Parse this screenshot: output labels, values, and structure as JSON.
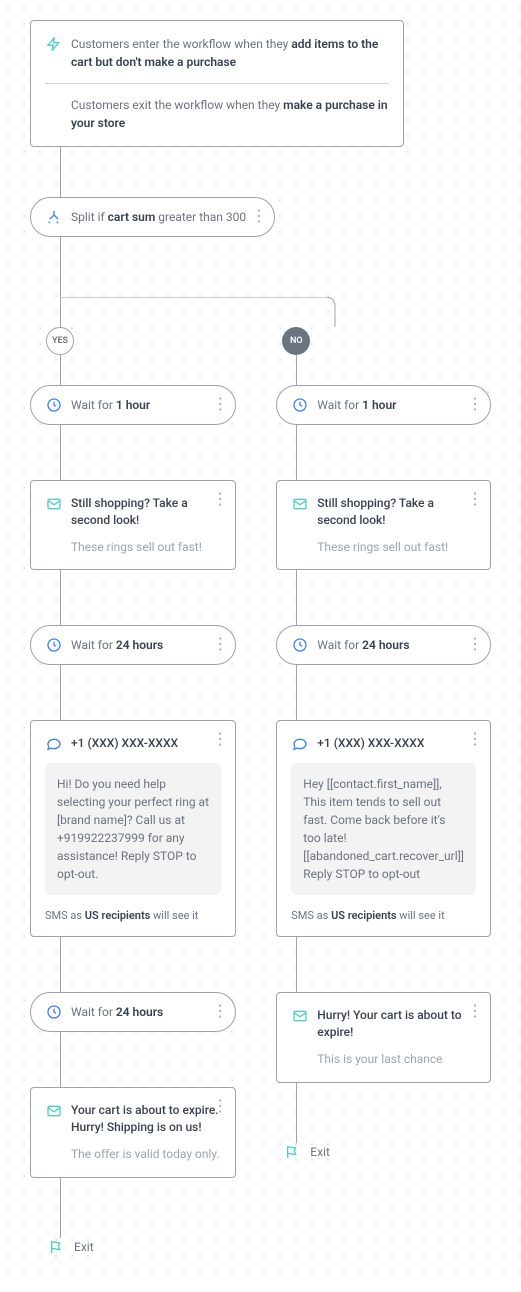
{
  "entry": {
    "part1": "Customers enter the workflow when they ",
    "bold1": "add items to the cart but don't make a purchase",
    "part2": "Customers exit the workflow when they ",
    "bold2": "make a purchase in your store"
  },
  "split": {
    "pre": "Split if ",
    "bold": "cart sum",
    "post": " greater than 300"
  },
  "badges": {
    "yes": "YES",
    "no": "NO"
  },
  "exit": "Exit",
  "yes": {
    "wait1": {
      "pre": "Wait for ",
      "dur": "1 hour"
    },
    "email1": {
      "title": "Still shopping? Take a second look!",
      "sub": "These rings sell out fast!"
    },
    "wait2": {
      "pre": "Wait for ",
      "dur": "24 hours"
    },
    "sms": {
      "num": "+1 (XXX) XXX-XXXX",
      "msg": "Hi! Do you need help selecting your perfect ring at [brand name]? Call us at +919922237999 for any assistance! Reply STOP to opt-out.",
      "note_pre": "SMS as ",
      "note_b": "US recipients",
      "note_post": " will see it"
    },
    "wait3": {
      "pre": "Wait for ",
      "dur": "24 hours"
    },
    "email2": {
      "title": "Your cart is about to expire. Hurry! Shipping is on us!",
      "sub": "The offer is valid today only."
    }
  },
  "no": {
    "wait1": {
      "pre": "Wait for ",
      "dur": "1 hour"
    },
    "email1": {
      "title": "Still shopping? Take a second look!",
      "sub": "These rings sell out fast!"
    },
    "wait2": {
      "pre": "Wait for ",
      "dur": "24 hours"
    },
    "sms": {
      "num": "+1 (XXX) XXX-XXXX",
      "msg": "Hey [[contact.first_name]], This item tends to sell out fast. Come back before it's too late! [[abandoned_cart.recover_url]] Reply STOP to opt-out",
      "note_pre": "SMS as ",
      "note_b": "US recipients",
      "note_post": " will see it"
    },
    "email2": {
      "title": "Hurry! Your cart is about to expire!",
      "sub": "This is your last chance"
    }
  }
}
